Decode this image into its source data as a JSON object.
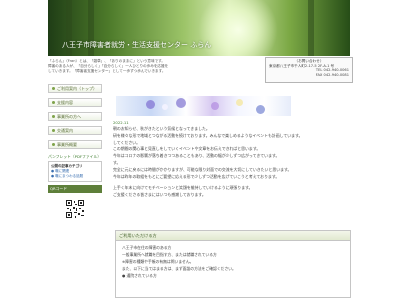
{
  "header": {
    "title": "八王子市障害者就労・生活支援センター ふらん"
  },
  "intro": {
    "lines": [
      "「ふらん」（Fran）とは、「雑草」、「ありのままに」という意味です。",
      "障害のある人が、「自分らしく」「自分らしく」一人ひとりの歩みを応援を",
      "していきます。「障害者支援センター」として一歩ずつ歩んでいきます。"
    ]
  },
  "contact": {
    "title": "〈お問い合わせ〉",
    "address": "東京都八王子市千人町2-17-5 2F-A-1 号",
    "tel": "TEL 042-940-0061",
    "fax": "FAX 042-940-0081"
  },
  "sidebar": {
    "nav": [
      {
        "label": "ご利用案内（トップ）"
      },
      {
        "label": "支援内容"
      },
      {
        "label": "事業所の方へ"
      },
      {
        "label": "交通案内"
      },
      {
        "label": "事業所概要"
      }
    ],
    "pamphlet": "パンフレット（PDFファイル）",
    "news_box": {
      "heading": "公開の記事カテゴリ",
      "lines": [
        "● 職に関連",
        "● 職にまつわる話題"
      ]
    },
    "qr_label": "QRコード"
  },
  "main": {
    "date": "2022.11",
    "paragraphs": [
      "朝のお知らせ、秋がきたという気候となってきました。",
      "研を様々な形で地域とつながる活動を続けております。みんなで楽しめるようなイベントも計画しています。",
      "してください。",
      "この期間の関心事と見直しをしていくイベントや文章をお伝えできればと思います。",
      "今年はコロナの影響が落ち着きつつあることもあり、活動の幅が少しずつ広がってきています。",
      "す。",
      "完全に元に戻るには時間がかかりますが、可能な限り対面での交流を大切にしていきたいと思います。",
      "今年は昨年の取組をもとにご要望に応える形で少しずつ活動を広げていこうと考えております。",
      "",
      "上手く年末に向けてモチベーションと笑顔を維持していけるように頑張ります。",
      "ご支援くださる皆さまにはいつも感謝しております。"
    ]
  },
  "notice": {
    "heading": "ご利用いただける方",
    "lines": [
      "八王子市在住の障害のある方",
      "一般事業所へ就職を目指す方、または就職されている方",
      "※障害の種類や手帳の有無は問いません。",
      "",
      "また、以下に当てはまる方は、まず面談の方法をご確認ください。",
      "● 通院されている方"
    ]
  }
}
